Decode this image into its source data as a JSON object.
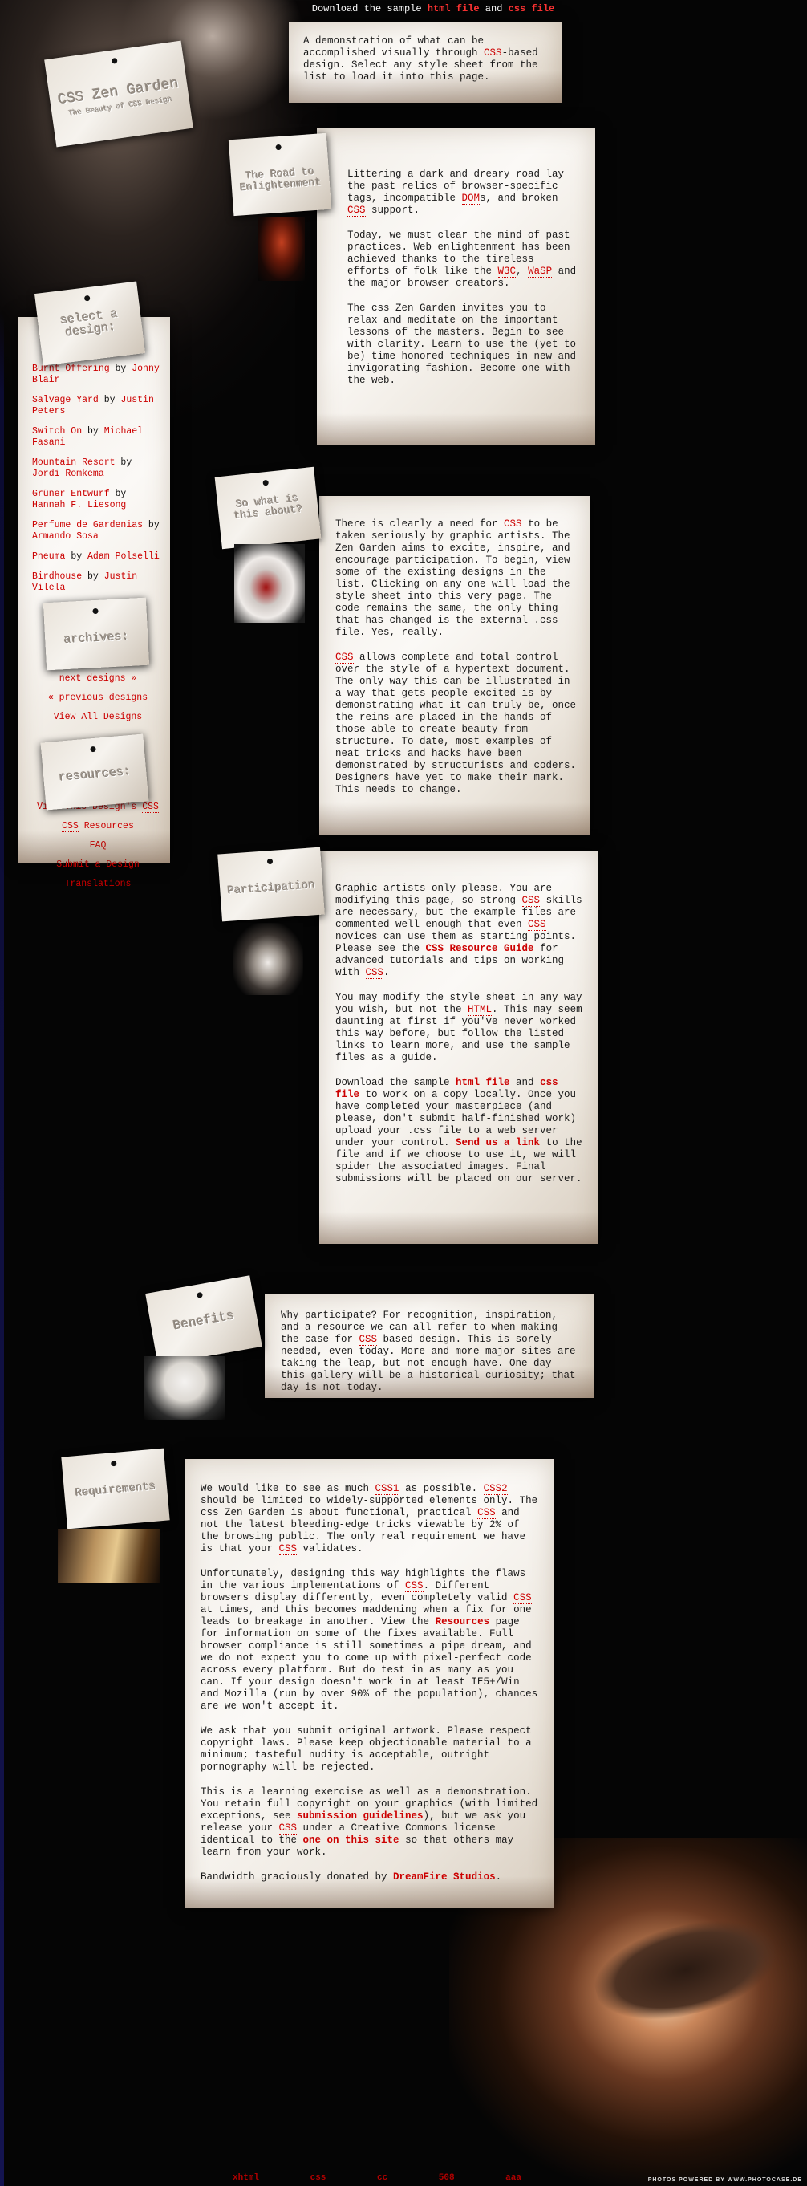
{
  "header": {
    "download_prefix": "Download the sample ",
    "html_file": "html file",
    "and": " and ",
    "css_file": "css file"
  },
  "logo": {
    "title": "CSS Zen Garden",
    "subtitle": "The Beauty of CSS Design"
  },
  "summary": {
    "p1_a": "A demonstration of what can be accomplished visually through ",
    "p1_css": "CSS",
    "p1_b": "-based design. Select any style sheet from the list to load it into this page."
  },
  "preamble": {
    "tag": "The Road to Enlightenment",
    "p1_a": "Littering a dark and dreary road lay the past relics of browser-specific tags, incompatible ",
    "p1_dom": "DOM",
    "p1_b": "s, and broken ",
    "p1_css": "CSS",
    "p1_c": " support.",
    "p2_a": "Today, we must clear the mind of past practices. Web enlightenment has been achieved thanks to the tireless efforts of folk like the ",
    "p2_w3c": "W3C",
    "p2_b": ", ",
    "p2_wasp": "WaSP",
    "p2_c": " and the major browser creators.",
    "p3": "The css Zen Garden invites you to relax and meditate on the important lessons of the masters. Begin to see with clarity. Learn to use the (yet to be) time-honored techniques in new and invigorating fashion. Become one with the web."
  },
  "explanation": {
    "tag": "So what is this about?",
    "p1_a": "There is clearly a need for ",
    "p1_css": "CSS",
    "p1_b": " to be taken seriously by graphic artists. The Zen Garden aims to excite, inspire, and encourage participation. To begin, view some of the existing designs in the list. Clicking on any one will load the style sheet into this very page. The code remains the same, the only thing that has changed is the external .css file. Yes, really.",
    "p2_css": "CSS",
    "p2_b": " allows complete and total control over the style of a hypertext document. The only way this can be illustrated in a way that gets people excited is by demonstrating what it can truly be, once the reins are placed in the hands of those able to create beauty from structure. To date, most examples of neat tricks and hacks have been demonstrated by structurists and coders. Designers have yet to make their mark. This needs to change."
  },
  "participation": {
    "tag": "Participation",
    "p1_a": "Graphic artists only please. You are modifying this page, so strong ",
    "p1_css": "CSS",
    "p1_b": " skills are necessary, but the example files are commented well enough that even ",
    "p1_css2": "CSS",
    "p1_c": " novices can use them as starting points. Please see the ",
    "p1_guide": "CSS Resource Guide",
    "p1_d": " for advanced tutorials and tips on working with ",
    "p1_css3": "CSS",
    "p1_e": ".",
    "p2_a": "You may modify the style sheet in any way you wish, but not the ",
    "p2_html": "HTML",
    "p2_b": ". This may seem daunting at first if you've never worked this way before, but follow the listed links to learn more, and use the sample files as a guide.",
    "p3_a": "Download the sample ",
    "p3_html": "html file",
    "p3_and": " and ",
    "p3_css": "css file",
    "p3_b": " to work on a copy locally. Once you have completed your masterpiece (and please, don't submit half-finished work) upload your .css file to a web server under your control. ",
    "p3_send": "Send us a link",
    "p3_c": " to the file and if we choose to use it, we will spider the associated images. Final submissions will be placed on our server."
  },
  "benefits": {
    "tag": "Benefits",
    "p1_a": "Why participate? For recognition, inspiration, and a resource we can all refer to when making the case for ",
    "p1_css": "CSS",
    "p1_b": "-based design. This is sorely needed, even today. More and more major sites are taking the leap, but not enough have. One day this gallery will be a historical curiosity; that day is not today."
  },
  "requirements": {
    "tag": "Requirements",
    "p1_a": "We would like to see as much ",
    "p1_css1": "CSS1",
    "p1_b": " as possible. ",
    "p1_css2": "CSS2",
    "p1_c": " should be limited to widely-supported elements only. The css Zen Garden is about functional, practical ",
    "p1_css": "CSS",
    "p1_d": " and not the latest bleeding-edge tricks viewable by 2% of the browsing public. The only real requirement we have is that your ",
    "p1_css3": "CSS",
    "p1_e": " validates.",
    "p2_a": "Unfortunately, designing this way highlights the flaws in the various implementations of ",
    "p2_css": "CSS",
    "p2_b": ". Different browsers display differently, even completely valid ",
    "p2_css2": "CSS",
    "p2_c": " at times, and this becomes maddening when a fix for one leads to breakage in another. View the ",
    "p2_res": "Resources",
    "p2_d": " page for information on some of the fixes available. Full browser compliance is still sometimes a pipe dream, and we do not expect you to come up with pixel-perfect code across every platform. But do test in as many as you can. If your design doesn't work in at least IE5+/Win and Mozilla (run by over 90% of the population), chances are we won't accept it.",
    "p3": "We ask that you submit original artwork. Please respect copyright laws. Please keep objectionable material to a minimum; tasteful nudity is acceptable, outright pornography will be rejected.",
    "p4_a": "This is a learning exercise as well as a demonstration. You retain full copyright on your graphics (with limited exceptions, see ",
    "p4_guide": "submission guidelines",
    "p4_b": "), but we ask you release your ",
    "p4_css": "CSS",
    "p4_c": " under a Creative Commons license identical to the ",
    "p4_one": "one on this site",
    "p4_d": " so that others may learn from your work.",
    "p5_a": "Bandwidth graciously donated by ",
    "p5_df": "DreamFire Studios",
    "p5_b": "."
  },
  "sidebar": {
    "select_tag": "select a design:",
    "designs": [
      {
        "name": "Burnt Offering",
        "by": " by ",
        "author": "Jonny Blair"
      },
      {
        "name": "Salvage Yard",
        "by": " by ",
        "author": "Justin Peters"
      },
      {
        "name": "Switch On",
        "by": " by ",
        "author": "Michael Fasani"
      },
      {
        "name": "Mountain Resort",
        "by": " by ",
        "author": "Jordi Romkema"
      },
      {
        "name": "Grüner Entwurf",
        "by": " by ",
        "author": "Hannah F. Liesong"
      },
      {
        "name": "Perfume de Gardenias",
        "by": " by ",
        "author": "Armando Sosa"
      },
      {
        "name": "Pneuma",
        "by": " by ",
        "author": "Adam Polselli"
      },
      {
        "name": "Birdhouse",
        "by": " by ",
        "author": "Justin Vilela"
      }
    ],
    "archives_tag": "archives:",
    "next": "next designs »",
    "previous": "« previous designs",
    "view_all": "View All Designs",
    "resources_tag": "resources:",
    "res_view_a": "View This Design's ",
    "res_view_css": "CSS",
    "res_css": "CSS",
    "res_css_b": " Resources",
    "res_faq": "FAQ",
    "res_submit": "Submit a Design",
    "res_translations": "Translations"
  },
  "footer": {
    "links": [
      "xhtml",
      "css",
      "cc",
      "508",
      "aaa"
    ],
    "credit": "PHOTOS POWERED BY WWW.PHOTOCASE.DE"
  },
  "colors": {
    "link": "#cc0000",
    "background": "#050505",
    "paper": "#f4f0ea"
  }
}
